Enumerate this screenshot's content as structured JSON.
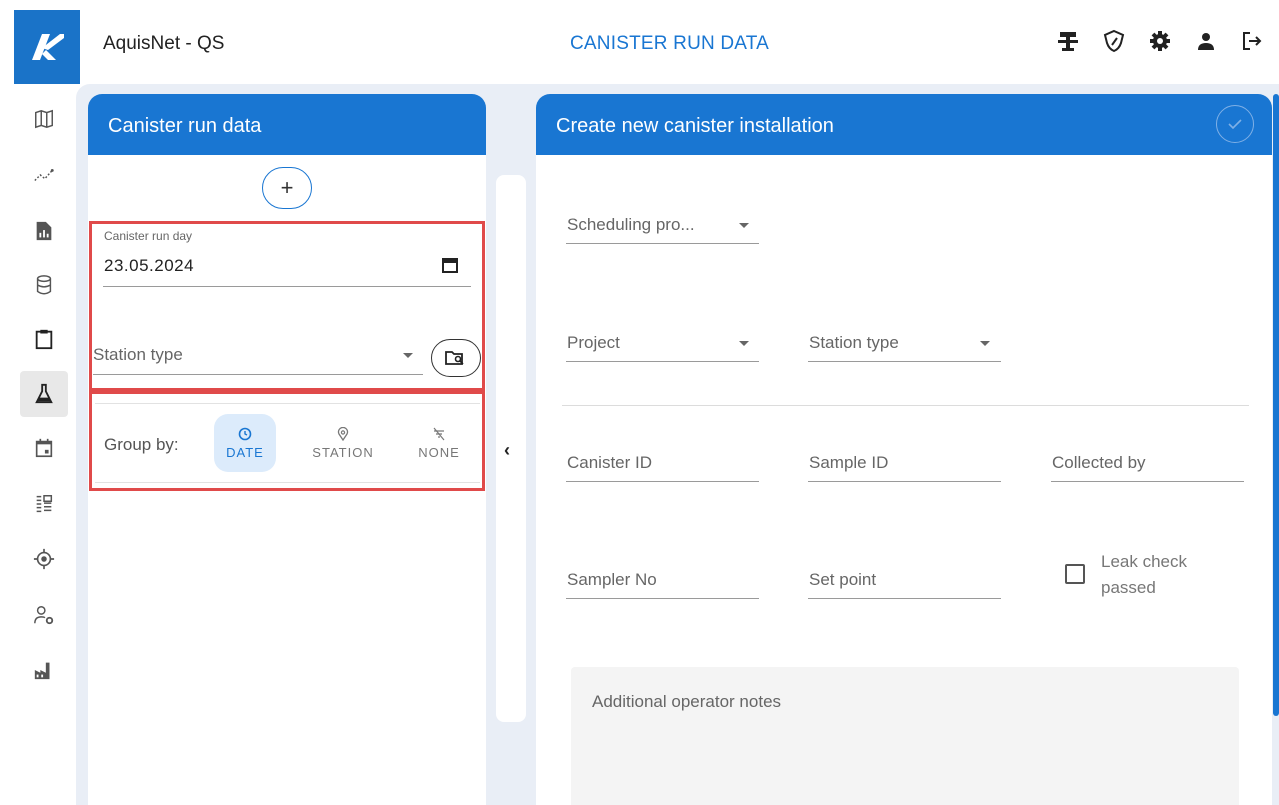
{
  "header": {
    "app_title": "AquisNet - QS",
    "page_heading": "CANISTER RUN DATA",
    "icons": [
      "station-icon",
      "shield-icon",
      "gear-icon",
      "user-icon",
      "logout-icon"
    ]
  },
  "nav": {
    "items": [
      "map-icon",
      "chart-line-icon",
      "report-icon",
      "database-icon",
      "clipboard-icon",
      "flask-icon",
      "calendar-icon",
      "list-icon",
      "target-icon",
      "user-settings-icon",
      "factory-icon"
    ],
    "active": "flask-icon"
  },
  "left_panel": {
    "title": "Canister run data",
    "add_label": "+",
    "run_day_label": "Canister run day",
    "run_day_value": "23.05.2024",
    "station_type_placeholder": "Station type",
    "group_by_label": "Group by:",
    "group_options": [
      {
        "label": "DATE",
        "icon": "clock-icon",
        "active": true
      },
      {
        "label": "STATION",
        "icon": "pin-icon",
        "active": false
      },
      {
        "label": "NONE",
        "icon": "no-group-icon",
        "active": false
      }
    ]
  },
  "right_panel": {
    "title": "Create new canister installation",
    "scheduling_placeholder": "Scheduling pro...",
    "project_placeholder": "Project",
    "station_type_placeholder": "Station type",
    "canister_id_placeholder": "Canister ID",
    "sample_id_placeholder": "Sample ID",
    "collected_by_placeholder": "Collected by",
    "sampler_no_placeholder": "Sampler No",
    "set_point_placeholder": "Set point",
    "leak_check_label": "Leak check passed",
    "notes_placeholder": "Additional operator notes"
  },
  "colors": {
    "primary": "#1976d2",
    "highlight": "#e04a4a",
    "canvas": "#e9eef6"
  }
}
